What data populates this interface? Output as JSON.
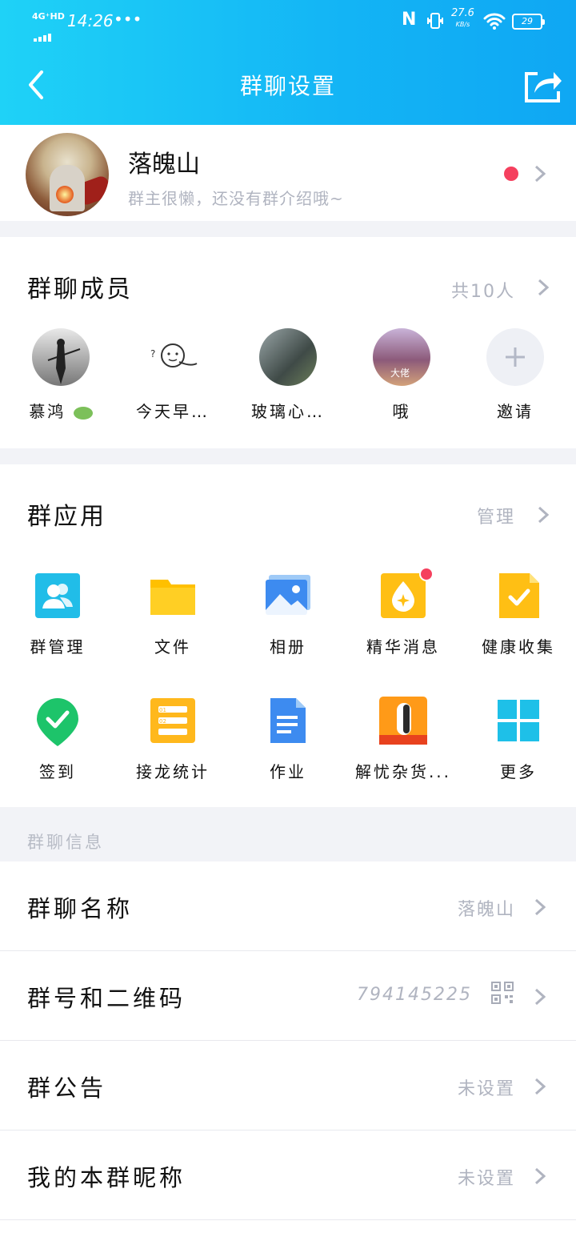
{
  "status_bar": {
    "network": "4G⁺HD",
    "time": "14:26",
    "dots": "•••",
    "nfc": "N",
    "speed_value": "27.6",
    "speed_unit": "KB/s",
    "battery": "29"
  },
  "header": {
    "title": "群聊设置",
    "back_icon": "back-arrow-icon",
    "share_icon": "share-icon"
  },
  "profile": {
    "name": "落魄山",
    "description": "群主很懒，还没有群介绍哦~"
  },
  "members": {
    "title": "群聊成员",
    "count": "共10人",
    "items": [
      {
        "name": "慕鸿"
      },
      {
        "name": "今天早…"
      },
      {
        "name": "玻璃心…"
      },
      {
        "name": "哦"
      },
      {
        "name": "邀请"
      }
    ]
  },
  "apps": {
    "title": "群应用",
    "manage": "管理",
    "items": [
      {
        "label": "群管理",
        "icon": "group-manage-icon"
      },
      {
        "label": "文件",
        "icon": "folder-icon"
      },
      {
        "label": "相册",
        "icon": "album-icon"
      },
      {
        "label": "精华消息",
        "icon": "essence-icon"
      },
      {
        "label": "健康收集",
        "icon": "health-collect-icon"
      },
      {
        "label": "签到",
        "icon": "checkin-icon"
      },
      {
        "label": "接龙统计",
        "icon": "chain-stat-icon"
      },
      {
        "label": "作业",
        "icon": "homework-icon"
      },
      {
        "label": "解忧杂货...",
        "icon": "store-icon"
      },
      {
        "label": "更多",
        "icon": "more-grid-icon"
      }
    ]
  },
  "info": {
    "section_label": "群聊信息",
    "rows": [
      {
        "label": "群聊名称",
        "value": "落魄山"
      },
      {
        "label": "群号和二维码",
        "value": "794145225"
      },
      {
        "label": "群公告",
        "value": "未设置"
      },
      {
        "label": "我的本群昵称",
        "value": "未设置"
      }
    ]
  },
  "colors": {
    "header_start": "#1fd2f7",
    "header_end": "#0fa7f3",
    "badge_red": "#f5405e",
    "muted": "#b0b4c0"
  }
}
